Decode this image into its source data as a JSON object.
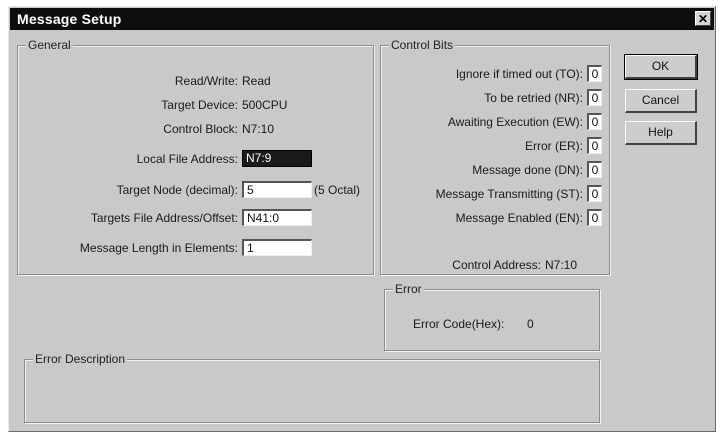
{
  "window": {
    "title": "Message Setup",
    "close_glyph": "✕"
  },
  "general": {
    "legend": "General",
    "read_write_label": "Read/Write:",
    "read_write_value": "Read",
    "target_device_label": "Target Device:",
    "target_device_value": "500CPU",
    "control_block_label": "Control Block:",
    "control_block_value": "N7:10",
    "local_file_label": "Local File Address:",
    "local_file_value": "N7:9",
    "target_node_label": "Target Node (decimal):",
    "target_node_value": "5",
    "target_node_octal": "(5 Octal)",
    "targets_file_label": "Targets File Address/Offset:",
    "targets_file_value": "N41:0",
    "msg_length_label": "Message Length in Elements:",
    "msg_length_value": "1"
  },
  "control_bits": {
    "legend": "Control Bits",
    "items": [
      {
        "label": "Ignore if timed out (TO):",
        "value": "0"
      },
      {
        "label": "To be retried (NR):",
        "value": "0"
      },
      {
        "label": "Awaiting Execution (EW):",
        "value": "0"
      },
      {
        "label": "Error (ER):",
        "value": "0"
      },
      {
        "label": "Message done (DN):",
        "value": "0"
      },
      {
        "label": "Message Transmitting (ST):",
        "value": "0"
      },
      {
        "label": "Message Enabled (EN):",
        "value": "0"
      }
    ],
    "control_address_label": "Control Address:",
    "control_address_value": "N7:10"
  },
  "error": {
    "legend": "Error",
    "code_label": "Error Code(Hex):",
    "code_value": "0"
  },
  "error_description": {
    "legend": "Error Description"
  },
  "buttons": {
    "ok": "OK",
    "cancel": "Cancel",
    "help": "Help"
  }
}
